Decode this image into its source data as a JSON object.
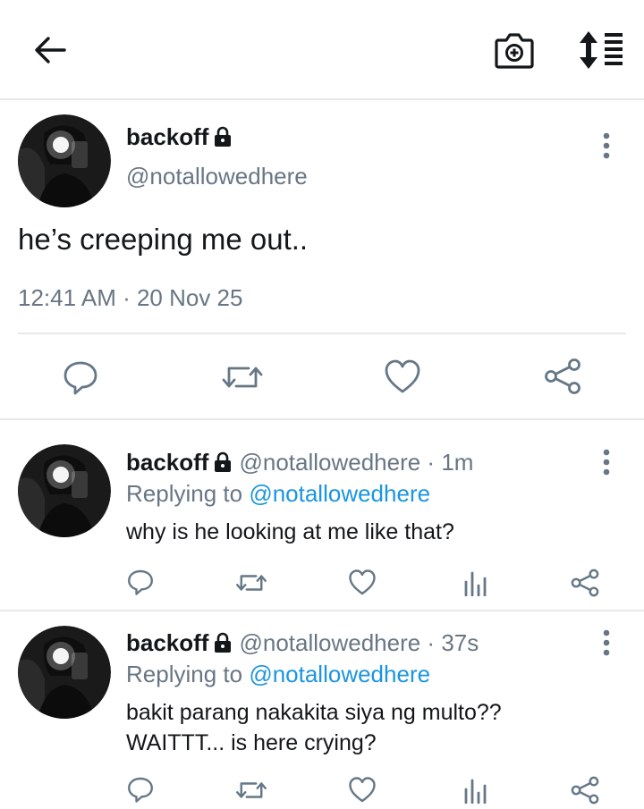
{
  "header": {
    "back_icon": "arrow-left-icon",
    "camera_icon": "camera-plus-icon",
    "sort_icon": "sort-list-icon"
  },
  "main_tweet": {
    "display_name": "backoff",
    "handle": "@notallowedhere",
    "text": "he’s creeping me out..",
    "timestamp": "12:41 AM · 20 Nov 25",
    "actions": [
      "reply-icon",
      "retweet-icon",
      "like-icon",
      "share-icon"
    ]
  },
  "replies": [
    {
      "display_name": "backoff",
      "handle_time": "@notallowedhere · 1m",
      "replying_prefix": "Replying to ",
      "replying_to": "@notallowedhere",
      "lines": [
        "why is he looking at me like that?"
      ]
    },
    {
      "display_name": "backoff",
      "handle_time": "@notallowedhere · 37s",
      "replying_prefix": "Replying to ",
      "replying_to": "@notallowedhere",
      "lines": [
        "bakit parang nakakita siya ng multo??",
        "WAITTT... is here crying?"
      ]
    }
  ],
  "colors": {
    "text": "#14171a",
    "secondary": "#687684",
    "link": "#1b95e0",
    "divider": "#e6e8ea",
    "icon": "#657786"
  }
}
